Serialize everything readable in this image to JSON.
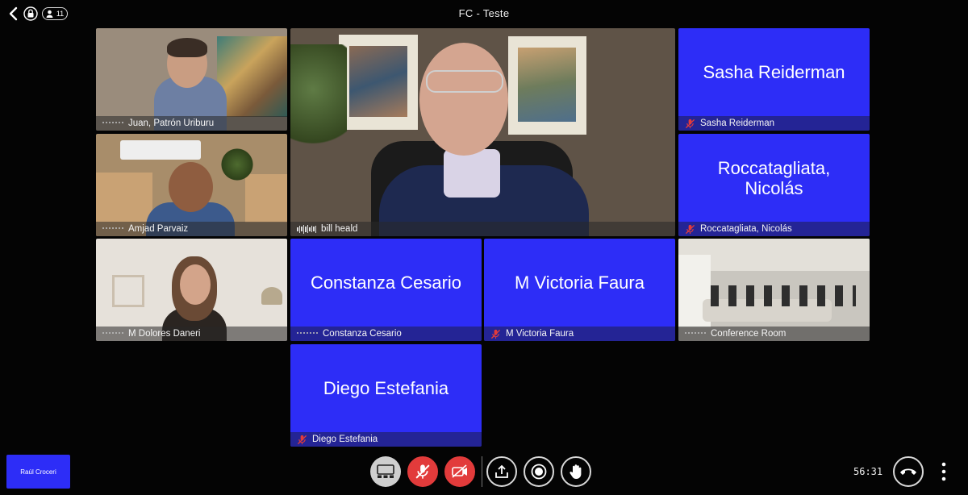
{
  "header": {
    "title": "FC - Teste",
    "participant_count": "11"
  },
  "tiles": {
    "juan": {
      "name": "Juan, Patrón Uriburu"
    },
    "bill": {
      "name": "bill heald"
    },
    "sasha": {
      "display": "Sasha Reiderman",
      "name": "Sasha Reiderman"
    },
    "amjad": {
      "name": "Amjad Parvaiz"
    },
    "roccatagliata": {
      "display_line1": "Roccatagliata,",
      "display_line2": "Nicolás",
      "name": "Roccatagliata, Nicolás"
    },
    "dolores": {
      "name": "M Dolores Daneri"
    },
    "constanza": {
      "display": "Constanza Cesario",
      "name": "Constanza Cesario"
    },
    "victoria": {
      "display": "M Victoria Faura",
      "name": "M Victoria Faura"
    },
    "conference": {
      "name": "Conference Room"
    },
    "diego": {
      "display": "Diego Estefania",
      "name": "Diego Estefania"
    }
  },
  "self_view": {
    "name": "Raúl Croceri"
  },
  "call": {
    "duration": "56:31"
  },
  "colors": {
    "tile_blue": "#2d2df7",
    "muted_red": "#e23b3b",
    "background": "#040404"
  },
  "icons": [
    "back-chevron-icon",
    "lock-icon",
    "person-icon",
    "mic-off-icon",
    "audio-wave-icon",
    "layout-icon",
    "camera-off-icon",
    "share-screen-icon",
    "record-icon",
    "raise-hand-icon",
    "hang-up-icon",
    "more-vertical-icon"
  ]
}
